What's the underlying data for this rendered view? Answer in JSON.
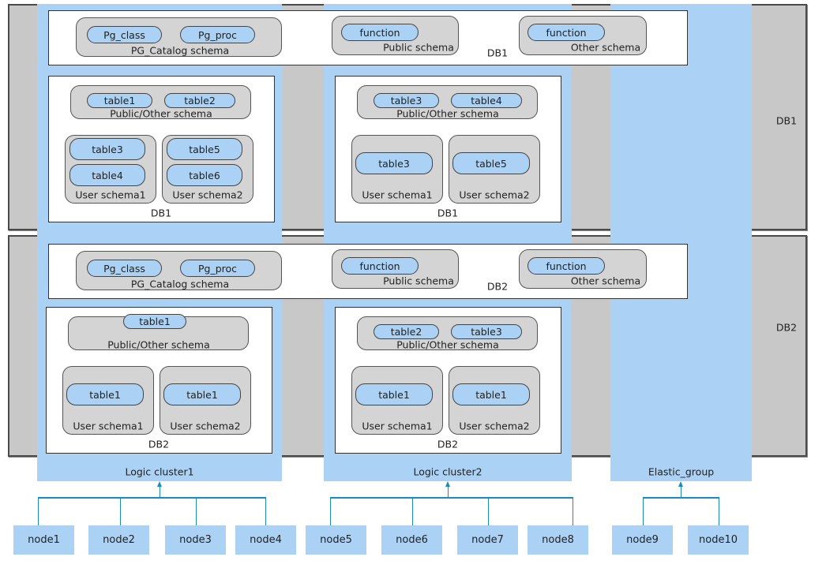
{
  "bands": [
    {
      "label": "DB1"
    },
    {
      "label": "DB2"
    }
  ],
  "groups": [
    {
      "label": "Logic cluster1"
    },
    {
      "label": "Logic cluster2"
    },
    {
      "label": "Elastic_group"
    }
  ],
  "catalog": [
    {
      "db": "DB1",
      "pg_catalog": {
        "label": "PG_Catalog schema",
        "items": [
          "Pg_class",
          "Pg_proc"
        ]
      },
      "public": {
        "label": "Public schema",
        "items": [
          "function"
        ]
      },
      "other": {
        "label": "Other schema",
        "items": [
          "function"
        ]
      }
    },
    {
      "db": "DB2",
      "pg_catalog": {
        "label": "PG_Catalog schema",
        "items": [
          "Pg_class",
          "Pg_proc"
        ]
      },
      "public": {
        "label": "Public schema",
        "items": [
          "function"
        ]
      },
      "other": {
        "label": "Other schema",
        "items": [
          "function"
        ]
      }
    }
  ],
  "databases": [
    {
      "db": "DB1",
      "cluster": "Logic cluster1",
      "public_other": {
        "label": "Public/Other schema",
        "items": [
          "table1",
          "table2"
        ]
      },
      "user_schemas": [
        {
          "label": "User schema1",
          "items": [
            "table3",
            "table4"
          ]
        },
        {
          "label": "User schema2",
          "items": [
            "table5",
            "table6"
          ]
        }
      ]
    },
    {
      "db": "DB1",
      "cluster": "Logic cluster2",
      "public_other": {
        "label": "Public/Other schema",
        "items": [
          "table3",
          "table4"
        ]
      },
      "user_schemas": [
        {
          "label": "User schema1",
          "items": [
            "table3"
          ]
        },
        {
          "label": "User schema2",
          "items": [
            "table5"
          ]
        }
      ]
    },
    {
      "db": "DB2",
      "cluster": "Logic cluster1",
      "public_other": {
        "label": "Public/Other schema",
        "items": [
          "table1"
        ]
      },
      "user_schemas": [
        {
          "label": "User schema1",
          "items": [
            "table1"
          ]
        },
        {
          "label": "User schema2",
          "items": [
            "table1"
          ]
        }
      ]
    },
    {
      "db": "DB2",
      "cluster": "Logic cluster2",
      "public_other": {
        "label": "Public/Other schema",
        "items": [
          "table2",
          "table3"
        ]
      },
      "user_schemas": [
        {
          "label": "User schema1",
          "items": [
            "table1"
          ]
        },
        {
          "label": "User schema2",
          "items": [
            "table1"
          ]
        }
      ]
    }
  ],
  "nodes": [
    "node1",
    "node2",
    "node3",
    "node4",
    "node5",
    "node6",
    "node7",
    "node8",
    "node9",
    "node10"
  ],
  "colors": {
    "band": "#c8c8c8",
    "group": "#abd2f4",
    "connector": "#1a8bbf",
    "schema": "#d4d4d4"
  }
}
